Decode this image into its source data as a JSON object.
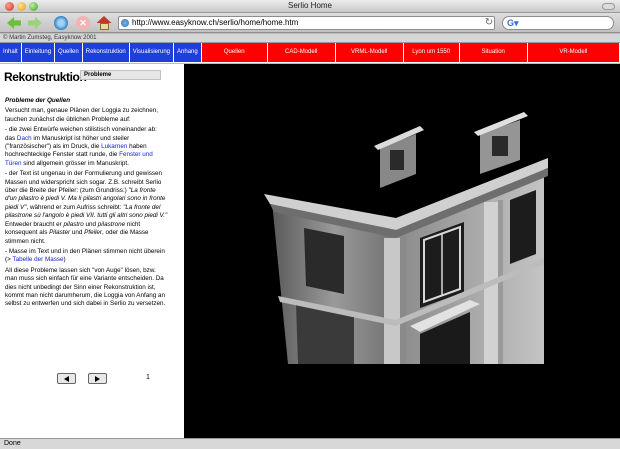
{
  "window": {
    "title": "Serlio Home"
  },
  "toolbar": {
    "url": "http://www.easyknow.ch/serlio/home/home.htm",
    "search_placeholder": "",
    "icons": [
      "back-arrow-icon",
      "forward-arrow-icon",
      "reload-icon",
      "stop-icon",
      "home-icon",
      "site-icon",
      "search-google-icon"
    ]
  },
  "bookmarks": {
    "text": "© Martin Zumsteg, Easyknow 2001"
  },
  "nav": {
    "blue_items": [
      "Inhalt",
      "Einleitung",
      "Quellen",
      "Rekonstruktion",
      "Visualisierung",
      "Anhang"
    ],
    "red_items": [
      "Quellen",
      "CAD-Modell",
      "VRML-Modell",
      "Lyon um 1550",
      "Situation",
      "VR-Modell"
    ],
    "colors": {
      "blue": "#1f3fd8",
      "red": "#ff0000"
    }
  },
  "page": {
    "section_title": "Rekonstruktion",
    "section_tab": "Probleme",
    "subtitle": "Probleme der Quellen",
    "p1": "Versucht man, genaue Plänen der Loggia zu zeichnen, tauchen zunächst die üblichen Probleme auf:",
    "p2": {
      "t1": "- die zwei Entwürfe weichen stilistisch voneinander ab: das ",
      "l1": "Dach",
      "t2": " im Manuskript ist höher und steiler (\"französischer\") als im Druck, die ",
      "l2": "Lukarnen",
      "t3": " haben hochrechteckige Fenster statt runde, die ",
      "l3": "Fenster und Türen",
      "t4": " sind allgemein grösser im Manuskript."
    },
    "p3": {
      "t1": "- der Text ist ungenau in der Formulierung und gewissen Massen und widerspricht sich sogar. Z.B. schreibt Serlio über die Breite der Pfeiler: (zum Grundriss:) ",
      "i1": "\"La fronte d'un pilastro è piedi V. Ma li pilastri angolari sono in fronte piedi V\"",
      "t2": ", während er zum Aufriss schreibt: ",
      "i2": "\"La fronte del pilastrone sù l'angolo è piedi VII. tutti gli altri sono piedi V.\"",
      "t3": " Entweder braucht er ",
      "i3": "pilastro",
      "t4": " und ",
      "i4": "pilastrone",
      "t5": " nicht konsequent als ",
      "i5": "Pilaster",
      "t6": " und ",
      "i6": "Pfeiler",
      "t7": ", oder die Masse stimmen nicht."
    },
    "p4": {
      "t1": "- Masse im Text und in den Plänen stimmen nicht überein (> ",
      "l1": "Tabelle der Masse",
      "t2": ")"
    },
    "p5": "All diese Probleme lassen sich \"von Auge\" lösen, bzw. man muss sich einfach für eine Variante entscheiden. Da dies nicht unbedingt der Sinn einer Rekonstruktion ist, kommt man nicht darumherum, die Loggia von Anfang an selbst zu entwerfen und sich dabei in Serlio zu versetzen.",
    "page_number": "1",
    "image_icon": "building-render-image"
  },
  "status": {
    "text": "Done"
  }
}
